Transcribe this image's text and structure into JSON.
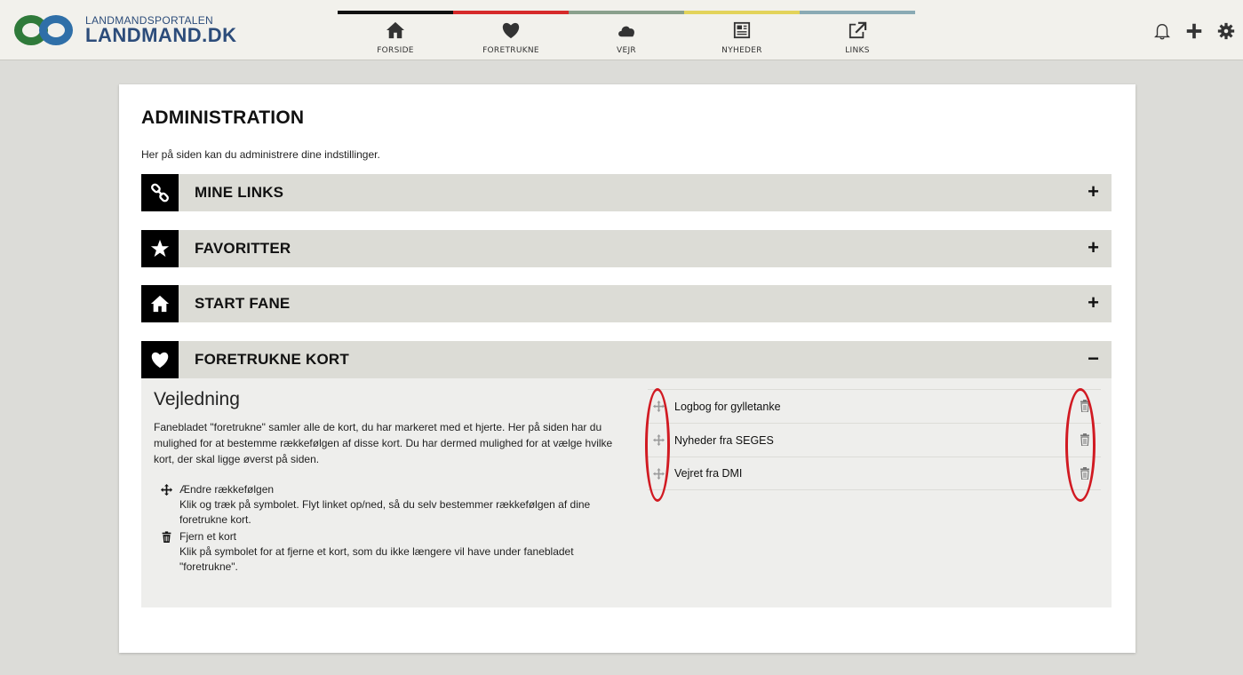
{
  "header": {
    "logo_small": "LANDMANDSPORTALEN",
    "logo_big": "LANDMAND.DK",
    "nav": [
      {
        "label": "FORSIDE",
        "icon": "home-icon",
        "strip": "#111111"
      },
      {
        "label": "FORETRUKNE",
        "icon": "heart-icon",
        "strip": "#d62a2a"
      },
      {
        "label": "VEJR",
        "icon": "cloud-icon",
        "strip": "#8aa08c"
      },
      {
        "label": "NYHEDER",
        "icon": "newspaper-icon",
        "strip": "#e3d35a"
      },
      {
        "label": "LINKS",
        "icon": "external-link-icon",
        "strip": "#8aaab4"
      }
    ],
    "right_icons": [
      "bell-icon",
      "plus-icon",
      "gear-icon"
    ]
  },
  "page": {
    "title": "ADMINISTRATION",
    "intro": "Her på siden kan du administrere dine indstillinger."
  },
  "sections": [
    {
      "label": "MINE LINKS",
      "icon": "link-icon",
      "toggle": "+"
    },
    {
      "label": "FAVORITTER",
      "icon": "star-icon",
      "toggle": "+"
    },
    {
      "label": "START FANE",
      "icon": "home-icon",
      "toggle": "+"
    },
    {
      "label": "FORETRUKNE KORT",
      "icon": "heart-icon",
      "toggle": "−"
    }
  ],
  "panel": {
    "heading": "Vejledning",
    "text": "Fanebladet \"foretrukne\" samler alle de kort, du har markeret med et hjerte. Her på siden har du mulighed for at bestemme rækkefølgen af disse kort. Du har dermed mulighed for at vælge hvilke kort, der skal ligge øverst på siden.",
    "legend": [
      {
        "title": "Ændre rækkefølgen",
        "icon": "move-icon",
        "desc": "Klik og træk på symbolet. Flyt linket op/ned, så du selv bestemmer rækkefølgen af dine foretrukne kort."
      },
      {
        "title": "Fjern et kort",
        "icon": "trash-icon",
        "desc": "Klik på symbolet for at fjerne et kort, som du ikke længere vil have under fanebladet \"foretrukne\"."
      }
    ],
    "cards": [
      "Logbog for gylletanke",
      "Nyheder fra SEGES",
      "Vejret fra DMI"
    ]
  },
  "colors": {
    "annotation": "#d11a22",
    "section_bg": "#dcdcd6",
    "panel_bg": "#eeeeec"
  }
}
